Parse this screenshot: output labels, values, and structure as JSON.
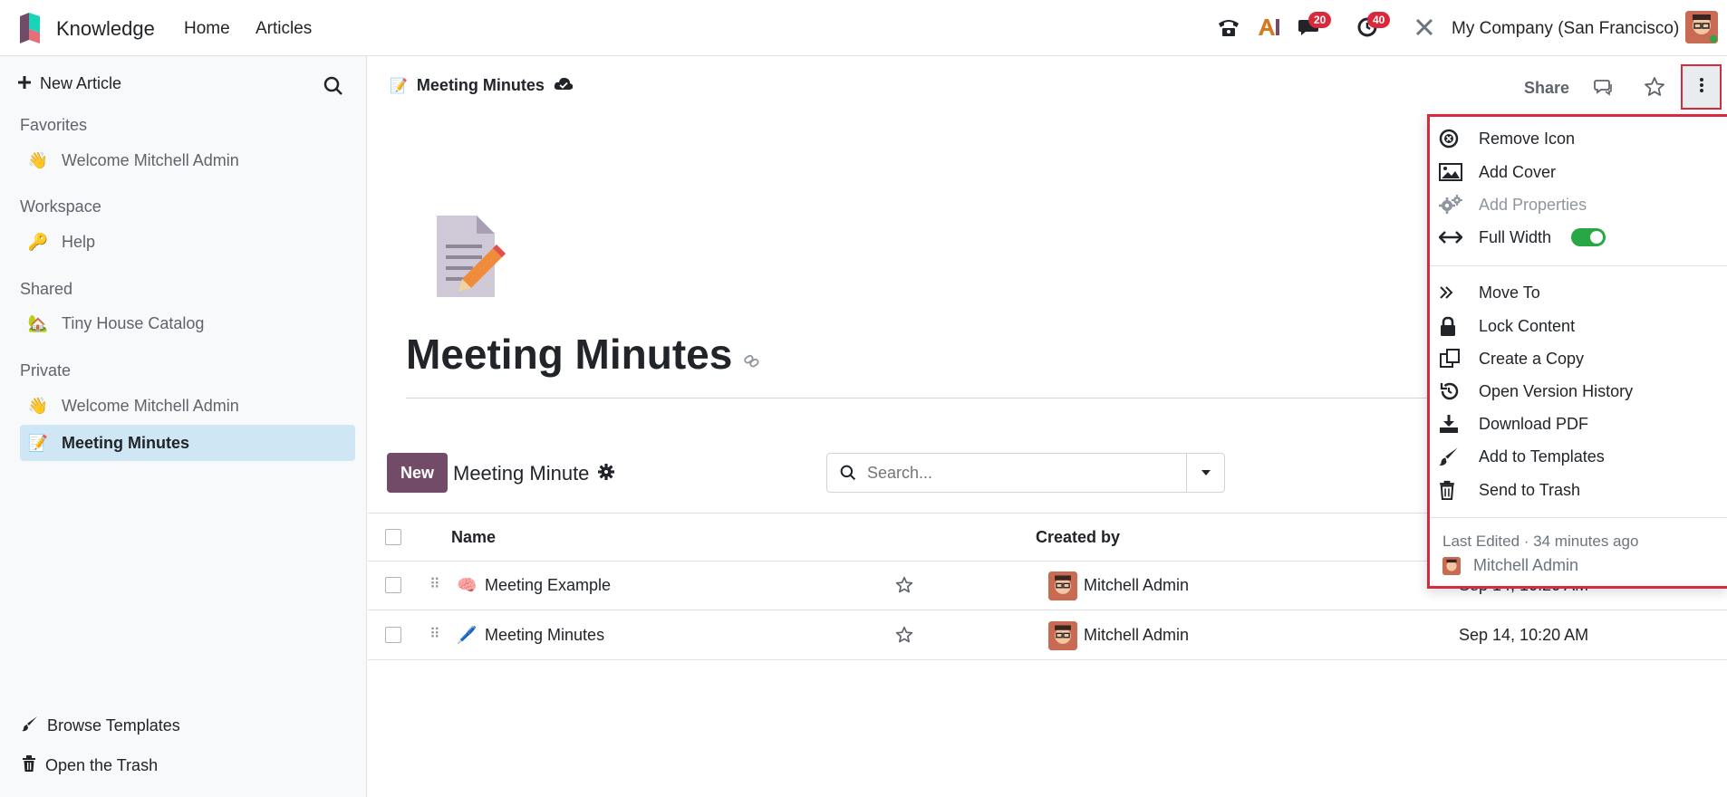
{
  "topbar": {
    "app_name": "Knowledge",
    "nav": [
      "Home",
      "Articles"
    ],
    "messages_count": "20",
    "activities_count": "40",
    "company": "My Company (San Francisco)"
  },
  "sidebar": {
    "new_article": "New Article",
    "sections": {
      "favorites": "Favorites",
      "workspace": "Workspace",
      "shared": "Shared",
      "private": "Private"
    },
    "items": {
      "fav_welcome": {
        "icon": "👋",
        "label": "Welcome Mitchell Admin"
      },
      "help": {
        "icon": "🔑",
        "label": "Help"
      },
      "tiny_house": {
        "icon": "🏡",
        "label": "Tiny House Catalog"
      },
      "priv_welcome": {
        "icon": "👋",
        "label": "Welcome Mitchell Admin"
      },
      "meeting_minutes": {
        "icon": "📝",
        "label": "Meeting Minutes"
      }
    },
    "browse_templates": "Browse Templates",
    "open_trash": "Open the Trash"
  },
  "article": {
    "breadcrumb": "Meeting Minutes",
    "share": "Share",
    "title": "Meeting Minutes"
  },
  "list": {
    "new_button": "New",
    "title": "Meeting Minute",
    "search_placeholder": "Search...",
    "columns": {
      "name": "Name",
      "created_by": "Created by"
    },
    "rows": [
      {
        "icon": "🧠",
        "name": "Meeting Example",
        "created_by": "Mitchell Admin",
        "date": "Sep 14, 10:20 AM"
      },
      {
        "icon": "🖊️",
        "name": "Meeting Minutes",
        "created_by": "Mitchell Admin",
        "date": "Sep 14, 10:20 AM"
      }
    ]
  },
  "menu": {
    "remove_icon": "Remove Icon",
    "add_cover": "Add Cover",
    "add_properties": "Add Properties",
    "full_width": "Full Width",
    "full_width_on": true,
    "move_to": "Move To",
    "lock_content": "Lock Content",
    "create_copy": "Create a Copy",
    "version_history": "Open Version History",
    "download_pdf": "Download PDF",
    "add_templates": "Add to Templates",
    "send_trash": "Send to Trash",
    "last_edited": "Last Edited · 34 minutes ago",
    "editor": "Mitchell Admin"
  },
  "colors": {
    "brand": "#714b67",
    "active_item": "#cfe7f5",
    "badge": "#d9293c",
    "toggle_on": "#28a745"
  }
}
